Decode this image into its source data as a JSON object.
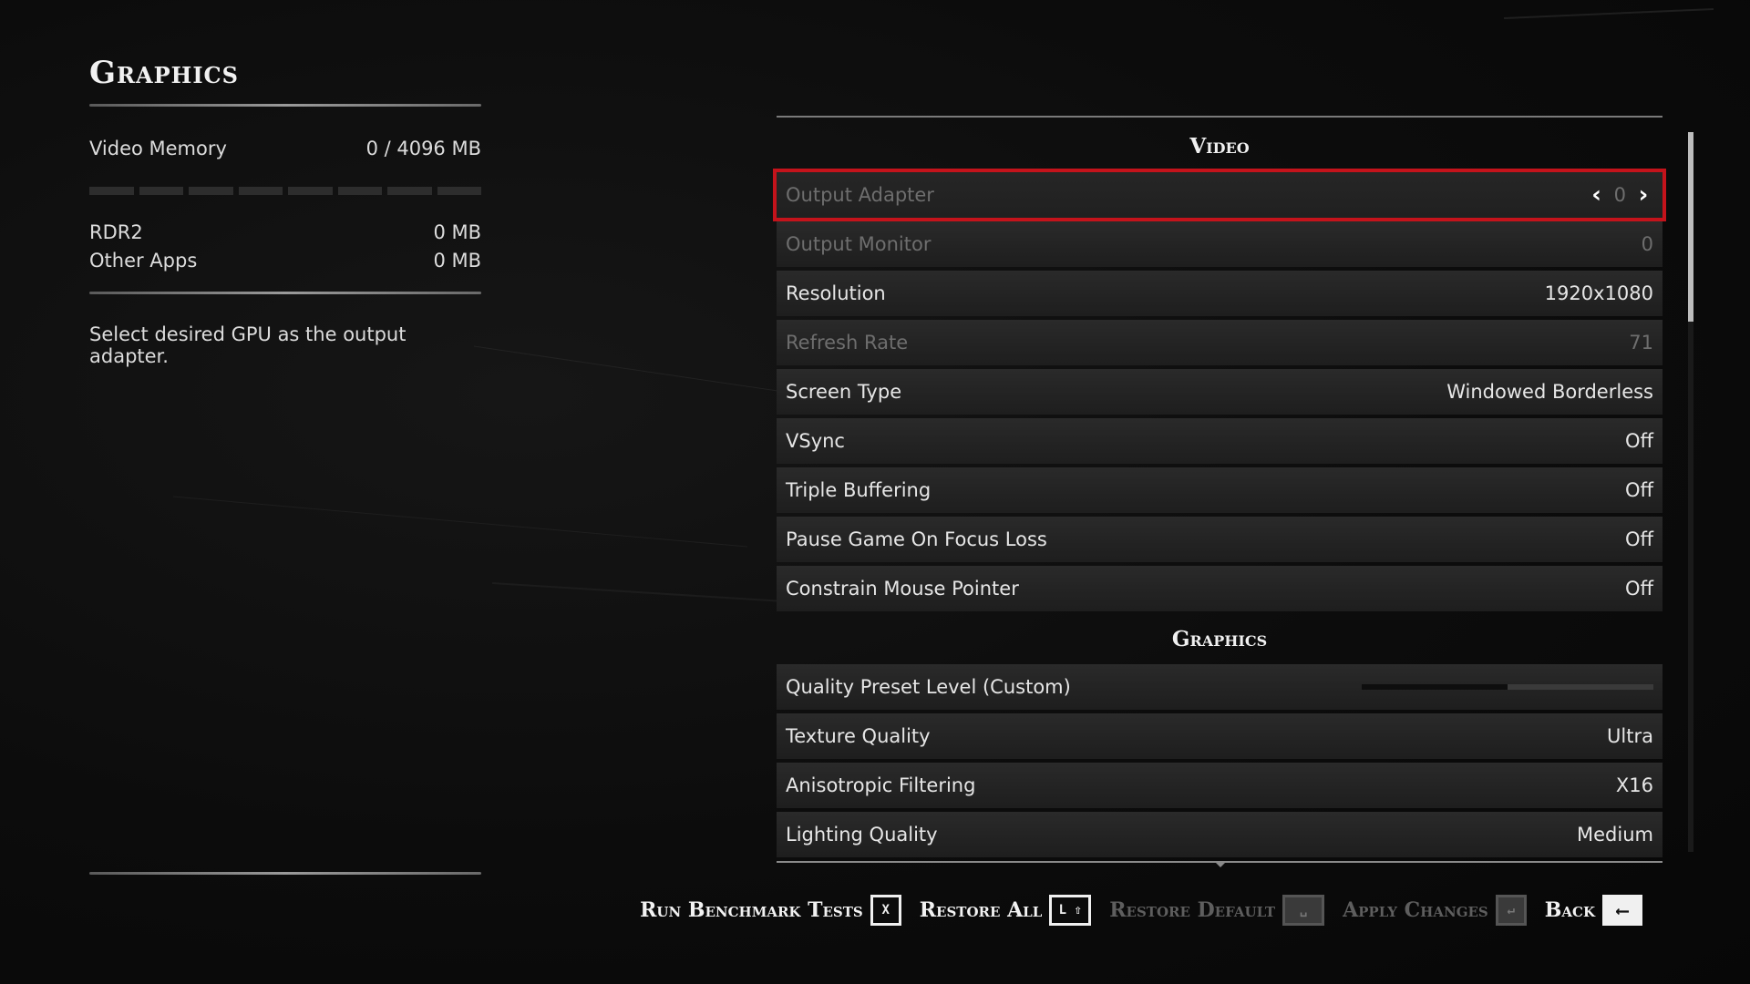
{
  "left": {
    "title": "Graphics",
    "video_memory": {
      "label": "Video Memory",
      "value": "0  / 4096  MB",
      "segments": 8,
      "fill_fraction": 0.0
    },
    "apps": [
      {
        "label": "RDR2",
        "value": "0  MB"
      },
      {
        "label": "Other Apps",
        "value": "0  MB"
      }
    ],
    "description": "Select desired GPU as the output adapter."
  },
  "sections": {
    "video": {
      "header": "Video",
      "rows": [
        {
          "label": "Output Adapter",
          "value": "0",
          "state": "selected-disabled",
          "arrows": true
        },
        {
          "label": "Output Monitor",
          "value": "0",
          "state": "disabled"
        },
        {
          "label": "Resolution",
          "value": "1920x1080",
          "state": "normal"
        },
        {
          "label": "Refresh Rate",
          "value": "71",
          "state": "disabled"
        },
        {
          "label": "Screen Type",
          "value": "Windowed Borderless",
          "state": "normal"
        },
        {
          "label": "VSync",
          "value": "Off",
          "state": "normal"
        },
        {
          "label": "Triple Buffering",
          "value": "Off",
          "state": "normal"
        },
        {
          "label": "Pause Game On Focus Loss",
          "value": "Off",
          "state": "normal"
        },
        {
          "label": "Constrain Mouse Pointer",
          "value": "Off",
          "state": "normal"
        }
      ]
    },
    "graphics": {
      "header": "Graphics",
      "rows": [
        {
          "label": "Quality Preset Level (Custom)",
          "slider_fraction": 0.5,
          "state": "normal"
        },
        {
          "label": "Texture Quality",
          "value": "Ultra",
          "state": "normal"
        },
        {
          "label": "Anisotropic Filtering",
          "value": "X16",
          "state": "normal"
        },
        {
          "label": "Lighting Quality",
          "value": "Medium",
          "state": "normal"
        }
      ]
    }
  },
  "footer": {
    "run_benchmark": {
      "label": "Run Benchmark Tests",
      "key": "X"
    },
    "restore_all": {
      "label": "Restore All",
      "key": "L ⇧"
    },
    "restore_default": {
      "label": "Restore Default",
      "key": "␣"
    },
    "apply_changes": {
      "label": "Apply Changes",
      "key": "↵"
    },
    "back": {
      "label": "Back",
      "key": "⟵"
    }
  },
  "colors": {
    "selection": "#c4131b",
    "background": "#0b0b0b"
  }
}
